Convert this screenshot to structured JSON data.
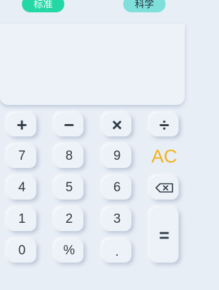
{
  "tabs": {
    "standard": "标准",
    "science": "科学"
  },
  "display": {
    "expression": "",
    "result": ""
  },
  "keys": {
    "plus": "+",
    "minus": "−",
    "times": "×",
    "divide": "÷",
    "seven": "7",
    "eight": "8",
    "nine": "9",
    "ac": "AC",
    "four": "4",
    "five": "5",
    "six": "6",
    "one": "1",
    "two": "2",
    "three": "3",
    "equals": "=",
    "zero": "0",
    "percent": "%",
    "dot": "."
  },
  "icons": {
    "backspace": "backspace-icon"
  },
  "colors": {
    "tab_standard": "#24d8a6",
    "tab_science": "#7fe0db",
    "ac": "#f2b21b",
    "background": "#e8eef6"
  }
}
